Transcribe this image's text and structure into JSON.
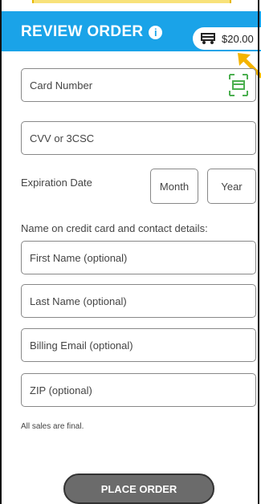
{
  "header": {
    "title": "REVIEW ORDER",
    "info_icon": "info-icon",
    "cart_total": "$20.00",
    "cart_icon": "cart-icon",
    "accent": "#1aa3e8"
  },
  "form": {
    "card_number_placeholder": "Card Number",
    "cvv_placeholder": "CVV or 3CSC",
    "expiration_label": "Expiration Date",
    "month_placeholder": "Month",
    "year_placeholder": "Year",
    "contact_label": "Name on credit card and contact details:",
    "first_name_placeholder": "First Name (optional)",
    "last_name_placeholder": "Last Name (optional)",
    "billing_email_placeholder": "Billing Email (optional)",
    "zip_placeholder": "ZIP (optional)"
  },
  "footer": {
    "note": "All sales are final.",
    "place_order_label": "PLACE ORDER"
  }
}
